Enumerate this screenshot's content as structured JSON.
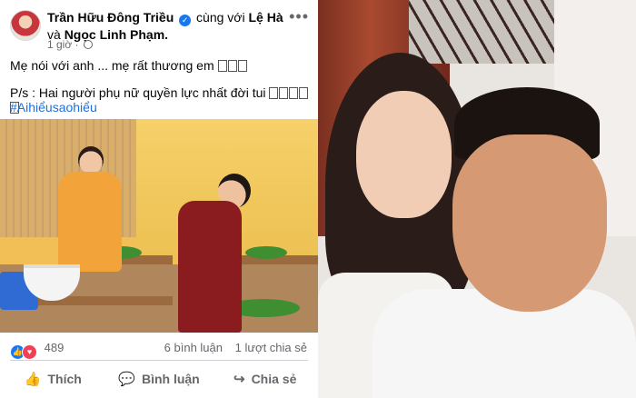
{
  "post": {
    "author": "Trần Hữu Đông Triều",
    "with_prefix": "cùng với",
    "tagged1": "Lệ Hà",
    "and_word": "và",
    "tagged2": "Ngọc Linh Phạm.",
    "time": "1 giờ",
    "line1": "Mẹ nói với anh ... mẹ rất thương em",
    "line2": "P/s : Hai người phụ nữ quyền lực nhất đời tui",
    "hashtag": "#Aihiểusaohiểu",
    "reaction_count": "489",
    "comments": "6 bình luận",
    "shares": "1 lượt chia sẻ",
    "actions": {
      "like": "Thích",
      "comment": "Bình luận",
      "share": "Chia sẻ"
    }
  },
  "icons": [
    "verified-icon",
    "globe-icon",
    "more-icon",
    "like-icon",
    "love-icon",
    "comment-icon",
    "share-icon"
  ],
  "colors": {
    "link": "#216fdb",
    "like": "#1877f2",
    "love": "#f33e58",
    "muted": "#65676b"
  }
}
